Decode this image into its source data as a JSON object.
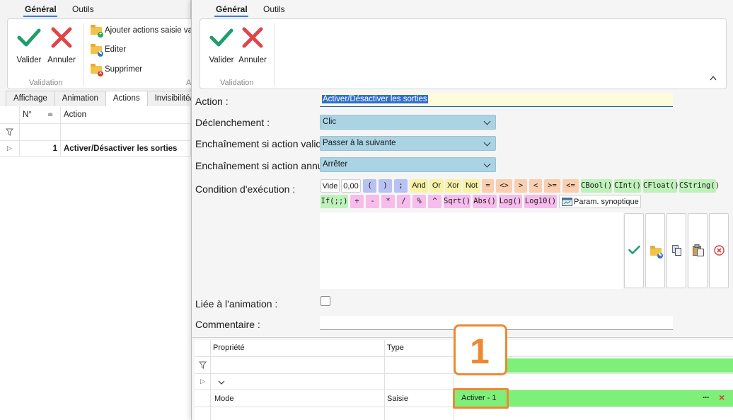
{
  "left_window": {
    "tabs": [
      "Général",
      "Outils"
    ],
    "ribbon": {
      "validate_label": "Valider",
      "cancel_label": "Annuler",
      "group_caption": "Validation",
      "group_caption2": "A",
      "commands": [
        "Ajouter actions saisie vale",
        "Editer",
        "Supprimer"
      ]
    },
    "subtabs": [
      "Affichage",
      "Animation",
      "Actions",
      "Invisibilité/Ver"
    ],
    "grid": {
      "headers": [
        "N°",
        "Action"
      ],
      "rows": [
        {
          "num": "1",
          "action": "Activer/Désactiver les sorties"
        }
      ]
    }
  },
  "dialog": {
    "tabs": [
      "Général",
      "Outils"
    ],
    "ribbon": {
      "validate_label": "Valider",
      "cancel_label": "Annuler",
      "group_caption": "Validation"
    },
    "fields": {
      "action_label": "Action :",
      "action_value": "Activer/Désactiver les sorties",
      "trigger_label": "Déclenchement :",
      "trigger_value": "Clic",
      "chain_valid_label": "Enchaînement si action validée :",
      "chain_valid_value": "Passer à la suivante",
      "chain_cancel_label": "Enchaînement si action annulée :",
      "chain_cancel_value": "Arrêter",
      "condition_label": "Condition d'exécution :",
      "linked_label": "Liée à l'animation :",
      "comment_label": "Commentaire :"
    },
    "tokens_row1": [
      "Vide",
      "0,00",
      "(",
      ")",
      ";",
      "And",
      "Or",
      "Xor",
      "Not",
      "=",
      "<>",
      ">",
      "<",
      ">=",
      "<=",
      "CBool()",
      "CInt()",
      "CFloat()",
      "CString()"
    ],
    "tokens_row2": [
      "If(;;)",
      "+",
      "-",
      "*",
      "/",
      "%",
      "^",
      "Sqrt()",
      "Abs()",
      "Log()",
      "Log10()",
      "Param. synoptique"
    ],
    "property_grid": {
      "headers": [
        "Propriété",
        "Type"
      ],
      "rows": [
        {
          "property": "Mode",
          "type": "Saisie",
          "value": "Activer - 1"
        }
      ],
      "ellipsis": "···",
      "clear_icon": "×"
    },
    "callout_number": "1"
  },
  "colors": {
    "accent_green": "#7ef07a",
    "callout_orange": "#ec8a32",
    "combo_blue": "#aad4e4",
    "check_green": "#1f9e6c",
    "cross_red": "#e0454a"
  }
}
